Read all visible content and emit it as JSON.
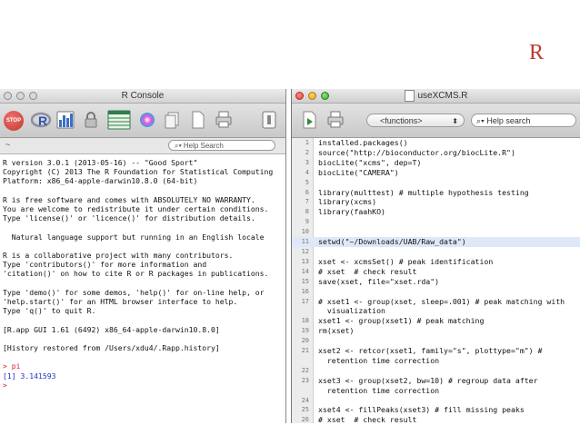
{
  "slide": {
    "title": "R"
  },
  "console": {
    "title": "R Console",
    "search_placeholder": "Help Search",
    "left_glyph": "~",
    "stop_label": "STOP",
    "lines": [
      "R version 3.0.1 (2013-05-16) -- \"Good Sport\"",
      "Copyright (C) 2013 The R Foundation for Statistical Computing",
      "Platform: x86_64-apple-darwin10.8.0 (64-bit)",
      "",
      "R is free software and comes with ABSOLUTELY NO WARRANTY.",
      "You are welcome to redistribute it under certain conditions.",
      "Type 'license()' or 'licence()' for distribution details.",
      "",
      "  Natural language support but running in an English locale",
      "",
      "R is a collaborative project with many contributors.",
      "Type 'contributors()' for more information and",
      "'citation()' on how to cite R or R packages in publications.",
      "",
      "Type 'demo()' for some demos, 'help()' for on-line help, or",
      "'help.start()' for an HTML browser interface to help.",
      "Type 'q()' to quit R.",
      "",
      "[R.app GUI 1.61 (6492) x86_64-apple-darwin10.8.0]",
      "",
      "[History restored from /Users/xdu4/.Rapp.history]",
      ""
    ],
    "prompt_cmd": "> pi",
    "result": "[1] 3.141593",
    "prompt_empty": ">"
  },
  "editor": {
    "title": "useXCMS.R",
    "functions_label": "<functions>",
    "search_placeholder": "Help search",
    "rows": [
      {
        "n": "1",
        "text": "installed.packages()"
      },
      {
        "n": "2",
        "text": "source(\"http://bioconductor.org/biocLite.R\")"
      },
      {
        "n": "3",
        "text": "biocLite(\"xcms\", dep=T)"
      },
      {
        "n": "4",
        "text": "biocLite(\"CAMERA\")"
      },
      {
        "n": "5",
        "text": ""
      },
      {
        "n": "6",
        "text": "library(multtest) # multiple hypothesis testing"
      },
      {
        "n": "7",
        "text": "library(xcms)"
      },
      {
        "n": "8",
        "text": "library(faahKO)"
      },
      {
        "n": "9",
        "text": ""
      },
      {
        "n": "10",
        "text": ""
      },
      {
        "n": "11",
        "text": "setwd(\"~/Downloads/UAB/Raw_data\")",
        "highlight": true
      },
      {
        "n": "12",
        "text": ""
      },
      {
        "n": "13",
        "text": "xset <- xcmsSet() # peak identification"
      },
      {
        "n": "14",
        "text": "# xset  # check result"
      },
      {
        "n": "15",
        "text": "save(xset, file=\"xset.rda\")"
      },
      {
        "n": "16",
        "text": ""
      },
      {
        "n": "17",
        "text": "# xset1 <- group(xset, sleep=.001) # peak matching with"
      },
      {
        "n": "",
        "text": "  visualization"
      },
      {
        "n": "18",
        "text": "xset1 <- group(xset1) # peak matching"
      },
      {
        "n": "19",
        "text": "rm(xset)"
      },
      {
        "n": "20",
        "text": ""
      },
      {
        "n": "21",
        "text": "xset2 <- retcor(xset1, family=\"s\", plottype=\"m\") #"
      },
      {
        "n": "",
        "text": "  retention time correction"
      },
      {
        "n": "22",
        "text": ""
      },
      {
        "n": "23",
        "text": "xset3 <- group(xset2, bw=10) # regroup data after"
      },
      {
        "n": "",
        "text": "  retention time correction"
      },
      {
        "n": "24",
        "text": ""
      },
      {
        "n": "25",
        "text": "xset4 <- fillPeaks(xset3) # fill missing peaks"
      },
      {
        "n": "26",
        "text": "# xset  # check result"
      }
    ]
  }
}
